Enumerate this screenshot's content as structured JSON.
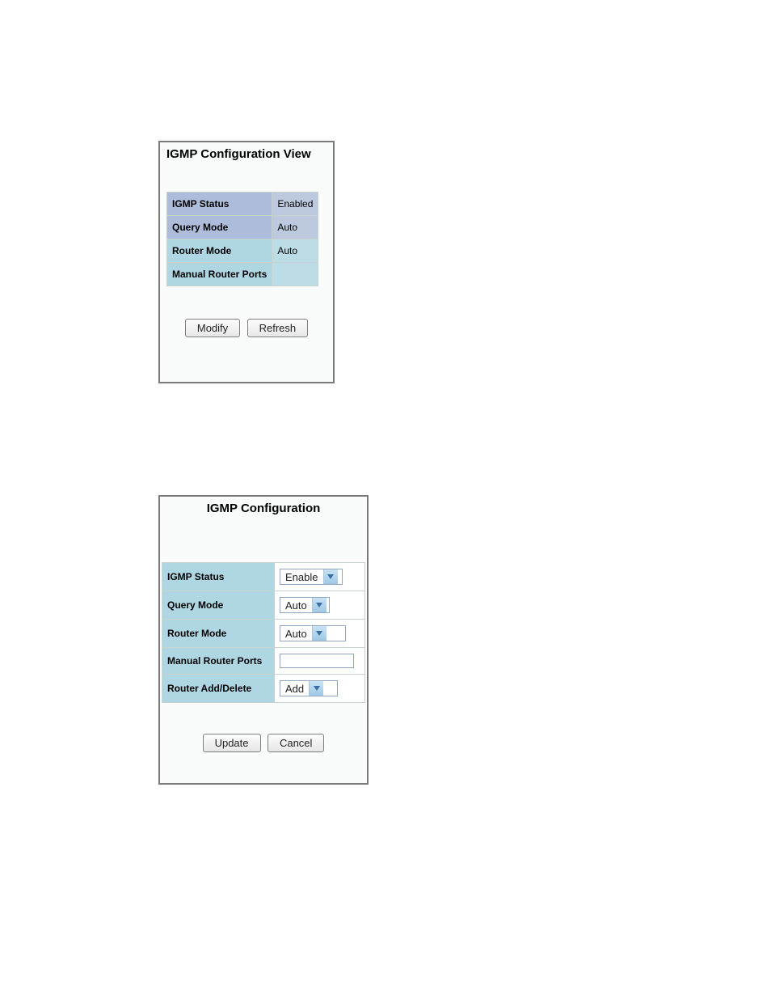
{
  "view": {
    "title": "IGMP Configuration View",
    "rows": {
      "igmp_status": {
        "label": "IGMP Status",
        "value": "Enabled"
      },
      "query_mode": {
        "label": "Query Mode",
        "value": "Auto"
      },
      "router_mode": {
        "label": "Router Mode",
        "value": "Auto"
      },
      "manual_router_ports": {
        "label": "Manual Router Ports",
        "value": ""
      }
    },
    "buttons": {
      "modify": "Modify",
      "refresh": "Refresh"
    }
  },
  "edit": {
    "title": "IGMP Configuration",
    "rows": {
      "igmp_status": {
        "label": "IGMP Status",
        "value": "Enable"
      },
      "query_mode": {
        "label": "Query Mode",
        "value": "Auto"
      },
      "router_mode": {
        "label": "Router Mode",
        "value": "Auto"
      },
      "manual_router_ports": {
        "label": "Manual Router Ports",
        "value": ""
      },
      "router_add_delete": {
        "label": "Router Add/Delete",
        "value": "Add"
      }
    },
    "buttons": {
      "update": "Update",
      "cancel": "Cancel"
    }
  }
}
